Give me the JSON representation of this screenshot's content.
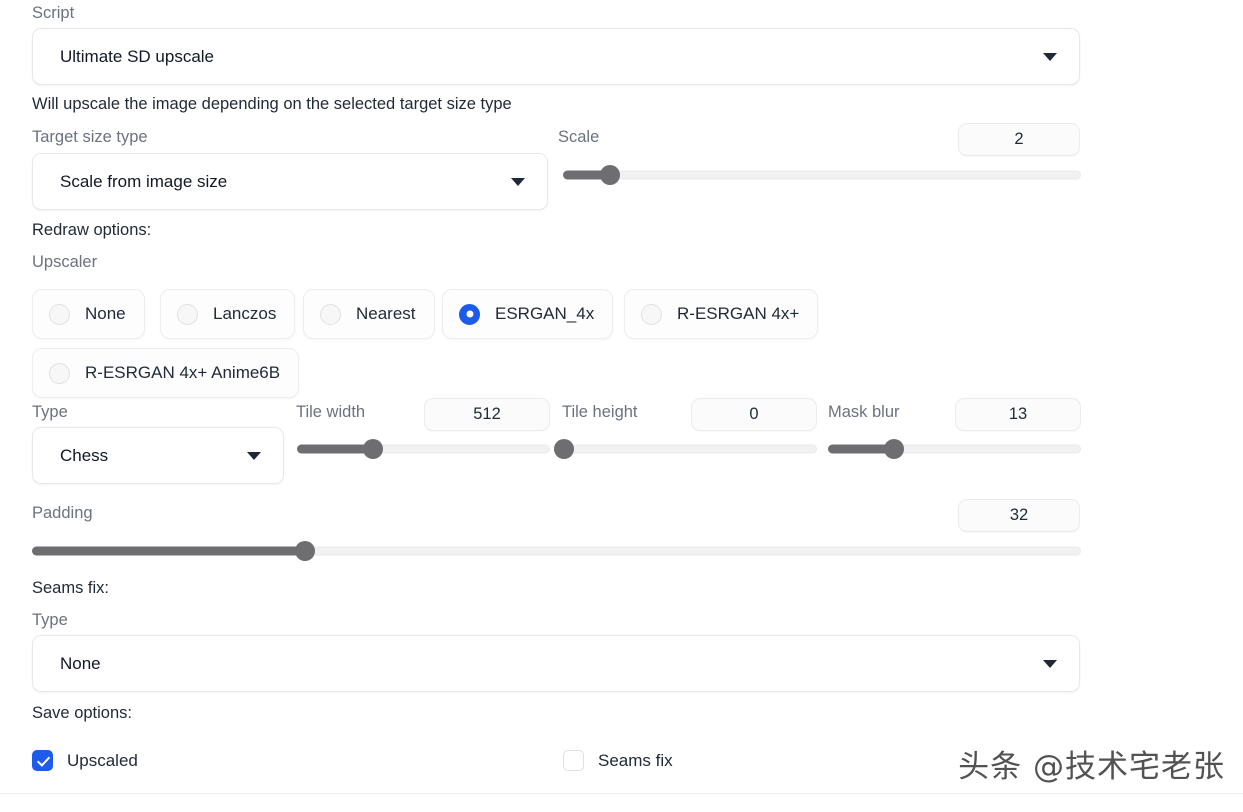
{
  "script_section": {
    "label": "Script",
    "selected": "Ultimate SD upscale",
    "arrow_icon": "chevron-down-icon",
    "description": "Will upscale the image depending on the selected target size type"
  },
  "target_size": {
    "label": "Target size type",
    "selected": "Scale from image size",
    "arrow_icon": "chevron-down-icon"
  },
  "scale": {
    "label": "Scale",
    "value": "2",
    "slider_percent": 9
  },
  "redraw": {
    "heading": "Redraw options:",
    "upscaler_label": "Upscaler",
    "upscalers": [
      {
        "label": "None",
        "selected": false
      },
      {
        "label": "Lanczos",
        "selected": false
      },
      {
        "label": "Nearest",
        "selected": false
      },
      {
        "label": "ESRGAN_4x",
        "selected": true
      },
      {
        "label": "R-ESRGAN 4x+",
        "selected": false
      },
      {
        "label": "R-ESRGAN 4x+ Anime6B",
        "selected": false
      }
    ]
  },
  "type_row": {
    "label": "Type",
    "selected": "Chess",
    "arrow_icon": "chevron-down-icon"
  },
  "tile_width": {
    "label": "Tile width",
    "value": "512",
    "slider_percent": 30
  },
  "tile_height": {
    "label": "Tile height",
    "value": "0",
    "slider_percent": 0
  },
  "mask_blur": {
    "label": "Mask blur",
    "value": "13",
    "slider_percent": 26
  },
  "padding": {
    "label": "Padding",
    "value": "32",
    "slider_percent": 26
  },
  "seams_fix": {
    "heading": "Seams fix:",
    "type_label": "Type",
    "selected": "None",
    "arrow_icon": "chevron-down-icon"
  },
  "save_options": {
    "heading": "Save options:",
    "items": [
      {
        "label": "Upscaled",
        "checked": true
      },
      {
        "label": "Seams fix",
        "checked": false
      }
    ]
  },
  "watermark": {
    "text": "头条 @技术宅老张"
  },
  "colors": {
    "accent": "#1d5bea",
    "slider_fill": "#6e6e70",
    "muted_text": "#6b7280",
    "dark_text": "#1f2937"
  }
}
